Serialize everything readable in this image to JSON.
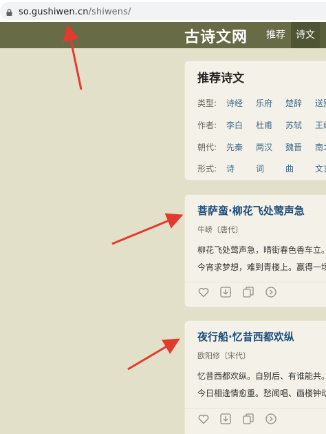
{
  "browser": {
    "url_domain": "so.gushiwen.cn",
    "url_path": "/shiwens/"
  },
  "site": {
    "logo": "古诗文网",
    "nav": [
      "推荐",
      "诗文"
    ]
  },
  "recommend": {
    "title": "推荐诗文",
    "rows": [
      {
        "label": "类型:",
        "items": [
          "诗经",
          "乐府",
          "楚辞",
          "送别"
        ]
      },
      {
        "label": "作者:",
        "items": [
          "李白",
          "杜甫",
          "苏轼",
          "王维"
        ]
      },
      {
        "label": "朝代:",
        "items": [
          "先秦",
          "两汉",
          "魏晋",
          "南北"
        ]
      },
      {
        "label": "形式:",
        "items": [
          "诗",
          "词",
          "曲",
          "文言"
        ]
      }
    ]
  },
  "poems": [
    {
      "title": "菩萨蛮·柳花飞处莺声急",
      "meta": "牛峤〔唐代〕",
      "line1": "柳花飞处莺声急，晴街春色香车立。",
      "line2": "今宵求梦想，难到青楼上。赢得一场"
    },
    {
      "title": "夜行船·忆昔西都欢纵",
      "meta": "欧阳修〔宋代〕",
      "line1": "忆昔西都欢纵。自别后、有谁能共。",
      "line2": "今日相逢情愈重。愁闻唱、画楼钟动"
    }
  ],
  "colors": {
    "header": "#676b46",
    "background": "#e2e0c9",
    "title_link": "#1f4e79",
    "arrow": "#e23b2e"
  },
  "icons": [
    "heart-icon",
    "download-icon",
    "copy-icon",
    "chevron-right-icon"
  ]
}
